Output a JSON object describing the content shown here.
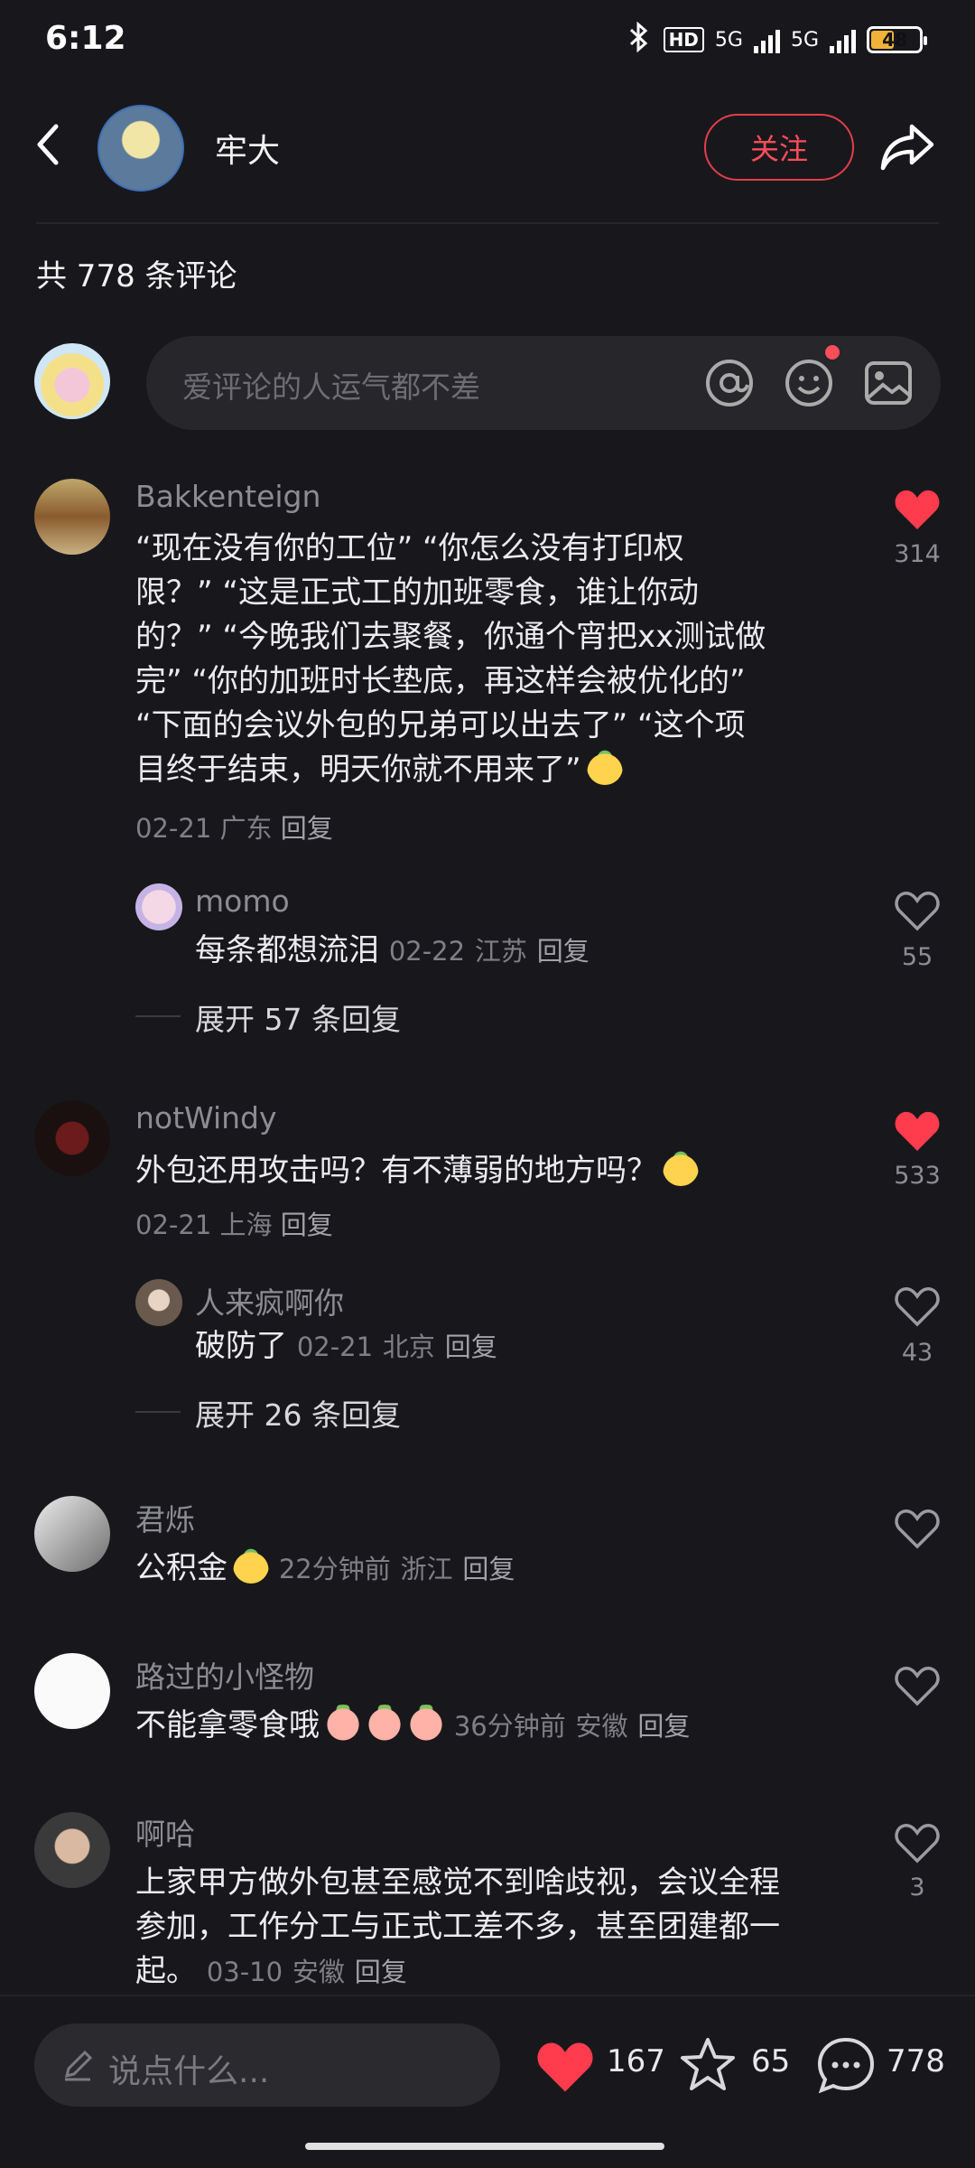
{
  "status": {
    "time": "6:12",
    "battery": "48",
    "hd": "HD",
    "net1": "5G",
    "net2": "5G"
  },
  "header": {
    "author": "牢大",
    "follow_label": "关注"
  },
  "comments_header": {
    "count_label": "共 778 条评论"
  },
  "input_top": {
    "placeholder": "爱评论的人运气都不差"
  },
  "comments": [
    {
      "user": "Bakkenteign",
      "text_lines": [
        "“现在没有你的工位” “你怎么没有打印权",
        "限？” “这是正式工的加班零食，谁让你动",
        "的？” “今晚我们去聚餐，你通个宵把xx测试做",
        "完” “你的加班时长垫底，再这样会被优化的”",
        "“下面的会议外包的兄弟可以出去了” “这个项",
        "目终于结束，明天你就不用来了”"
      ],
      "date": "02-21",
      "location": "广东",
      "reply": "回复",
      "likes": "314",
      "liked": true,
      "sub": {
        "user": "momo",
        "text": "每条都想流泪",
        "date": "02-22",
        "location": "江苏",
        "reply": "回复",
        "likes": "55"
      },
      "expand": "展开 57 条回复"
    },
    {
      "user": "notWindy",
      "text": "外包还用攻击吗？有不薄弱的地方吗？",
      "date": "02-21",
      "location": "上海",
      "reply": "回复",
      "likes": "533",
      "liked": true,
      "sub": {
        "user": "人来疯啊你",
        "text": "破防了",
        "date": "02-21",
        "location": "北京",
        "reply": "回复",
        "likes": "43"
      },
      "expand": "展开 26 条回复"
    },
    {
      "user": "君烁",
      "text": "公积金",
      "date": "22分钟前",
      "location": "浙江",
      "reply": "回复",
      "liked": false
    },
    {
      "user": "路过的小怪物",
      "text": "不能拿零食哦",
      "date": "36分钟前",
      "location": "安徽",
      "reply": "回复",
      "liked": false
    },
    {
      "user": "啊哈",
      "text_lines": [
        "上家甲方做外包甚至感觉不到啥歧视，会议全程",
        "参加，工作分工与正式工差不多，甚至团建都一",
        "起。"
      ],
      "date": "03-10",
      "location": "安徽",
      "reply": "回复",
      "likes": "3",
      "liked": false
    }
  ],
  "bottom": {
    "placeholder": "说点什么...",
    "like_count": "167",
    "fav_count": "65",
    "comment_count": "778"
  },
  "colors": {
    "accent": "#ff4d5a",
    "bg": "#18181c"
  }
}
